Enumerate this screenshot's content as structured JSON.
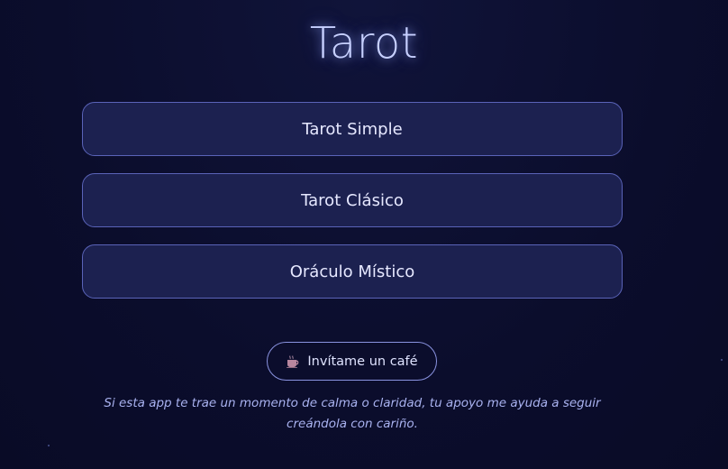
{
  "header": {
    "title": "Tarot"
  },
  "menu": {
    "items": [
      {
        "label": "Tarot Simple"
      },
      {
        "label": "Tarot Clásico"
      },
      {
        "label": "Oráculo Místico"
      }
    ]
  },
  "support": {
    "button_label": "Invítame un café",
    "button_icon": "coffee-cup-icon",
    "message": "Si esta app te trae un momento de calma o claridad, tu apoyo me ayuda a seguir creándola con cariño."
  },
  "colors": {
    "background": "#0b0d2c",
    "button_fill": "#1c2150",
    "button_border": "#5a63b8",
    "title_glow": "#c7d0ff",
    "note_text": "#a9b2f0"
  }
}
